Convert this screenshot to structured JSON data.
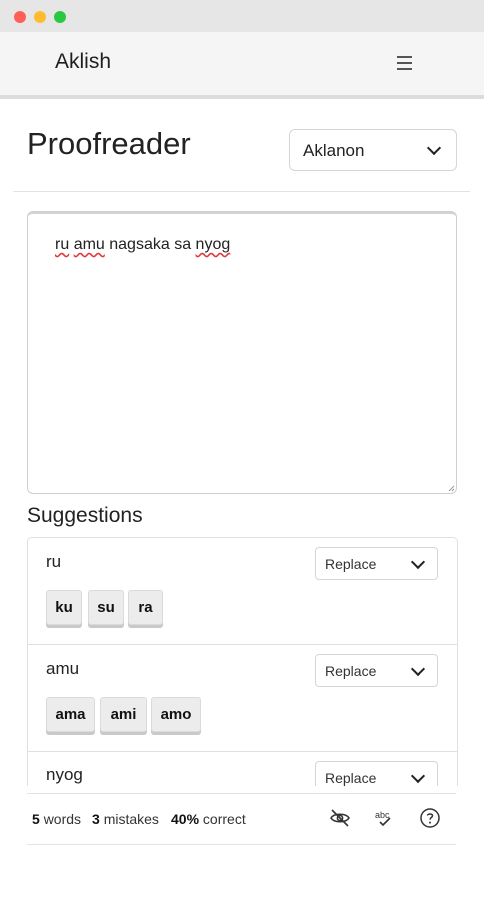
{
  "header": {
    "brand": "Aklish",
    "menu_icon": "hamburger-icon"
  },
  "main": {
    "title": "Proofreader",
    "language": {
      "selected": "Aklanon"
    },
    "editor": {
      "segments": [
        {
          "text": "ru",
          "error": true
        },
        {
          "text": " ",
          "error": false
        },
        {
          "text": "amu",
          "error": true
        },
        {
          "text": " nagsaka sa ",
          "error": false
        },
        {
          "text": "nyog",
          "error": true
        }
      ]
    }
  },
  "suggestions": {
    "title": "Suggestions",
    "action_label": "Replace",
    "items": [
      {
        "word": "ru",
        "options": [
          "ku",
          "su",
          "ra"
        ]
      },
      {
        "word": "amu",
        "options": [
          "ama",
          "ami",
          "amo"
        ]
      },
      {
        "word": "nyog",
        "options": []
      }
    ]
  },
  "status": {
    "words_count": "5",
    "words_label": "words",
    "mistakes_count": "3",
    "mistakes_label": "mistakes",
    "correct_pct": "40%",
    "correct_label": "correct",
    "icons": [
      "hide-eye-icon",
      "spellcheck-icon",
      "help-icon"
    ]
  },
  "colors": {
    "error_underline": "#e03a3a",
    "chip_bg": "#ececec",
    "appbar_bg": "#f5f5f5"
  }
}
